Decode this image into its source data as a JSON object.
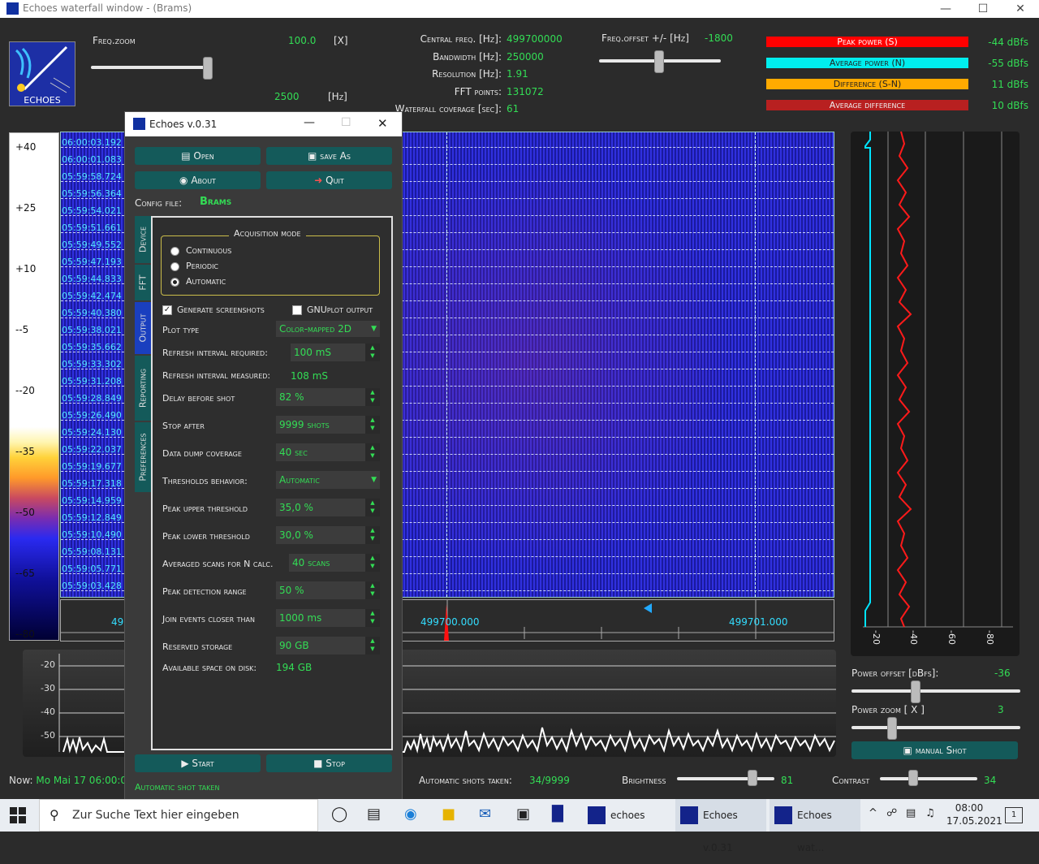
{
  "window": {
    "title": "Echoes waterfall window - (Brams)"
  },
  "top": {
    "freq_zoom_label": "Freq.zoom",
    "freq_zoom_value": "100.0",
    "freq_zoom_unit": "[X]",
    "bandwidth_value": "2500",
    "bandwidth_unit": "[Hz]",
    "central_freq_label": "Central freq. [Hz]:",
    "central_freq_value": "499700000",
    "bw_label": "Bandwidth [Hz]:",
    "bw_value": "250000",
    "res_label": "Resolution [Hz]:",
    "res_value": "1.91",
    "fft_label": "FFT points:",
    "fft_value": "131072",
    "wf_label": "Waterfall coverage [sec]:",
    "wf_value": "61",
    "freq_offset_label": "Freq.offset +/- [Hz]",
    "freq_offset_value": "-1800"
  },
  "power": [
    {
      "label": "Peak power (S)",
      "value": "-44 dBfs",
      "color": "#ff0000"
    },
    {
      "label": "Average power (N)",
      "value": "-55 dBfs",
      "color": "#00eeee"
    },
    {
      "label": "Difference (S-N)",
      "value": "11 dBfs",
      "color": "#ffaa00"
    },
    {
      "label": "Average difference",
      "value": "10 dBfs",
      "color": "#b82020"
    }
  ],
  "scale": [
    "+40",
    "+25",
    "+10",
    "--5",
    "--20",
    "--35",
    "--50",
    "--65",
    "--80"
  ],
  "timestamps": [
    "06:00:03.192",
    "06:00:01.083",
    "05:59:58.724",
    "05:59:56.364",
    "05:59:54.021",
    "05:59:51.661",
    "05:59:49.552",
    "05:59:47.193",
    "05:59:44.833",
    "05:59:42.474",
    "05:59:40.380",
    "05:59:38.021",
    "05:59:35.662",
    "05:59:33.302",
    "05:59:31.208",
    "05:59:28.849",
    "05:59:26.490",
    "05:59:24.130",
    "05:59:22.037",
    "05:59:19.677",
    "05:59:17.318",
    "05:59:14.959",
    "05:59:12.849",
    "05:59:10.490",
    "05:59:08.131",
    "05:59:05.771",
    "05:59:03.428"
  ],
  "freq_ticks": [
    "49",
    "499700.000",
    "499701.000"
  ],
  "spectrum_scale": [
    "-20",
    "-30",
    "-40",
    "-50"
  ],
  "right_ticks": [
    "-20",
    "-40",
    "-60",
    "-80"
  ],
  "right_controls": {
    "power_offset_label": "Power offset [dBfs]:",
    "power_offset_value": "-36",
    "power_zoom_label": "Power zoom  [ X ]",
    "power_zoom_value": "3",
    "manual_shot": "manual Shot"
  },
  "status": {
    "now_label": "Now:",
    "now_value": "Mo Mai 17 06:00:04",
    "auto_shots_label": "Automatic shots taken:",
    "auto_shots_value": "34/9999",
    "brightness_label": "Brightness",
    "brightness_value": "81",
    "contrast_label": "Contrast",
    "contrast_value": "34"
  },
  "dialog": {
    "title": "Echoes v.0.31",
    "open": "Open",
    "save_as": "save As",
    "about": "About",
    "quit": "Quit",
    "config_label": "Config file:",
    "config_value": "Brams",
    "tabs": [
      "Device",
      "FFT",
      "Output",
      "Reporting",
      "Preferences"
    ],
    "acq_title": "Acquisition mode",
    "acq_modes": [
      "Continuous",
      "Periodic",
      "Automatic"
    ],
    "gen_screens": "Generate screenshots",
    "gnuplot": "GNUplot output",
    "plot_type_label": "Plot type",
    "plot_type_value": "Color-mapped 2D",
    "refresh_req_label": "Refresh interval  required:",
    "refresh_req_value": "100 mS",
    "refresh_meas_label": "Refresh interval measured:",
    "refresh_meas_value": "108 mS",
    "delay_label": "Delay before shot",
    "delay_value": "82 %",
    "stop_label": "Stop after",
    "stop_value": "9999 shots",
    "dump_label": "Data dump coverage",
    "dump_value": "40 sec",
    "thr_label": "Thresholds behavior:",
    "thr_value": "Automatic",
    "peak_up_label": "Peak upper threshold",
    "peak_up_value": "35,0 %",
    "peak_low_label": "Peak lower threshold",
    "peak_low_value": "30,0 %",
    "avg_scans_label": "Averaged scans for N calc.",
    "avg_scans_value": "40 scans",
    "peak_range_label": "Peak detection range",
    "peak_range_value": "50 %",
    "join_label": "Join events closer than",
    "join_value": "1000 ms",
    "reserved_label": "Reserved storage",
    "reserved_value": "90 GB",
    "avail_label": "Available space on disk:",
    "avail_value": "194 GB",
    "start": "Start",
    "stop": "Stop",
    "status": "Automatic shot taken"
  },
  "taskbar": {
    "search_placeholder": "Zur Suche Text hier eingeben",
    "apps": [
      "echoes",
      "Echoes v.0.31",
      "Echoes wat..."
    ],
    "time": "08:00",
    "date": "17.05.2021",
    "notif": "1"
  }
}
